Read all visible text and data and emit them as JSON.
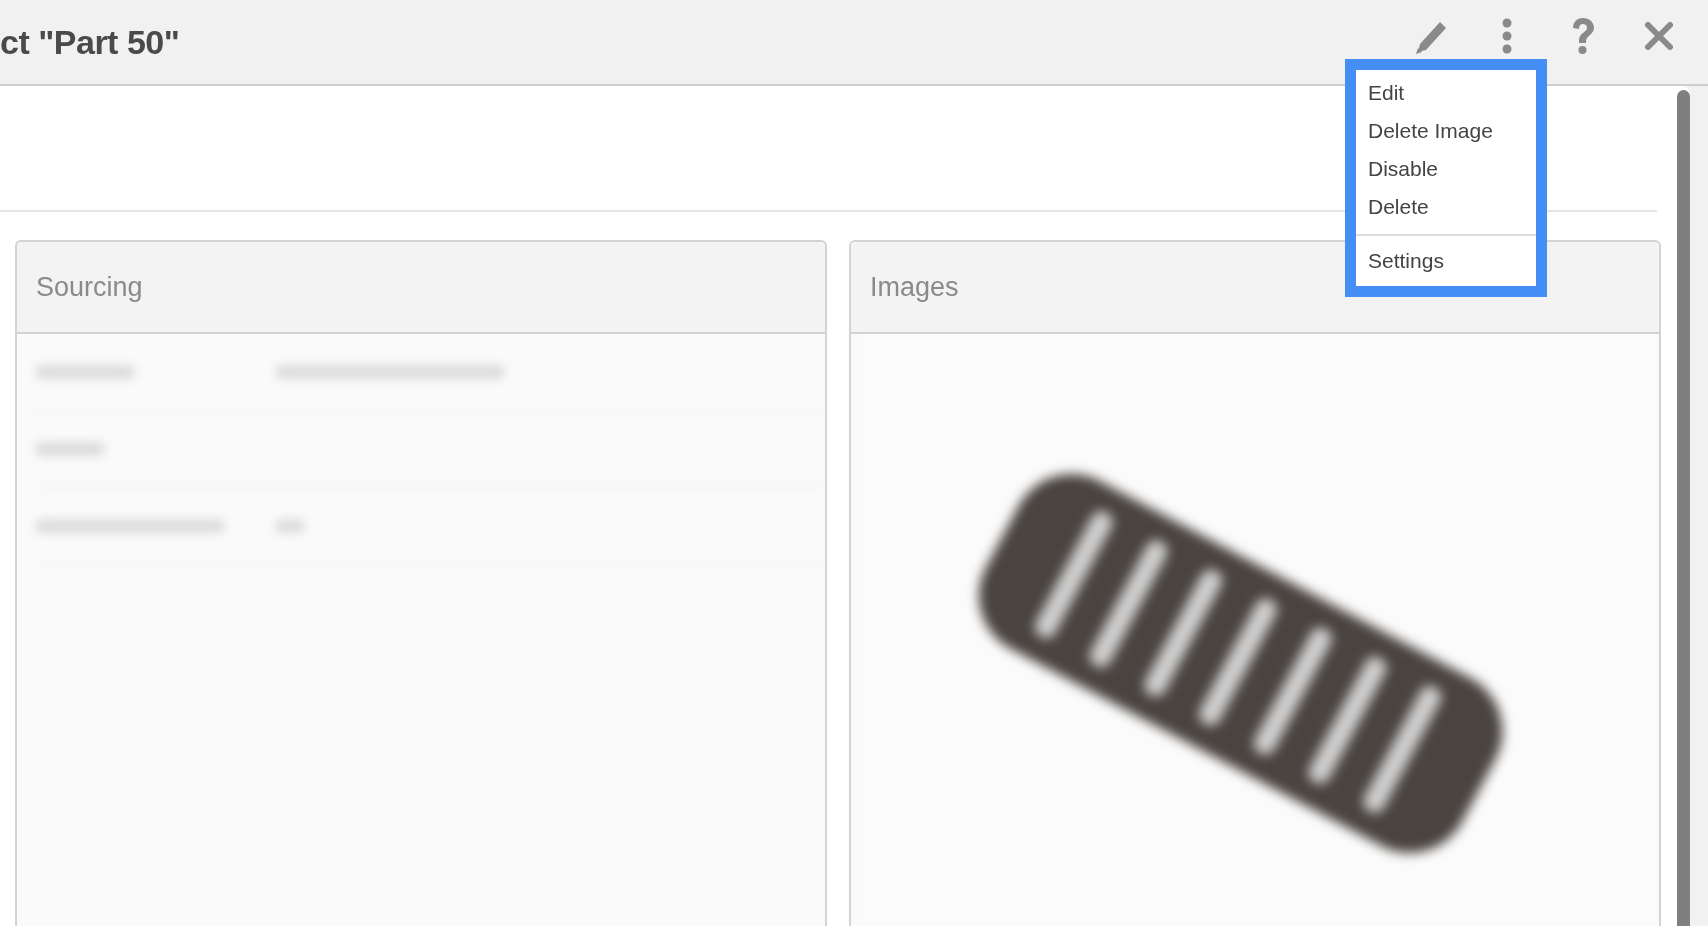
{
  "header": {
    "title": "ct \"Part 50\"",
    "actions": [
      {
        "kind": "edit"
      },
      {
        "kind": "more",
        "expanded": true
      },
      {
        "kind": "help"
      },
      {
        "kind": "close"
      }
    ]
  },
  "menu": {
    "groups": [
      [
        "Edit",
        "Delete Image",
        "Disable",
        "Delete"
      ],
      [
        "Settings"
      ]
    ]
  },
  "cards": [
    {
      "title": "Sourcing",
      "kind": "form"
    },
    {
      "title": "Images",
      "kind": "image"
    }
  ]
}
